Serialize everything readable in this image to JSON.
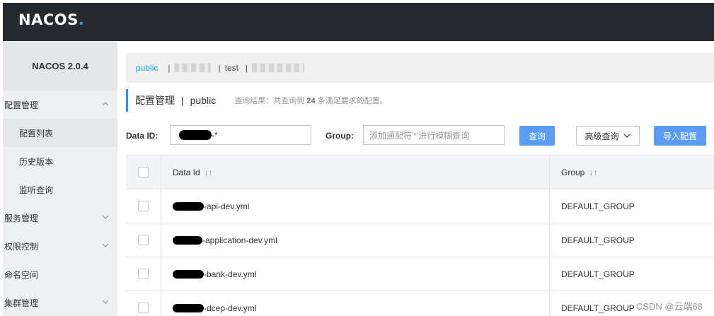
{
  "header": {
    "logo_text": "NACOS",
    "logo_dot": "."
  },
  "sidebar": {
    "version": "NACOS 2.0.4",
    "groups": [
      {
        "label": "配置管理",
        "expanded": true,
        "items": [
          {
            "label": "配置列表",
            "active": true
          },
          {
            "label": "历史版本"
          },
          {
            "label": "监听查询"
          }
        ]
      },
      {
        "label": "服务管理",
        "expanded": false
      },
      {
        "label": "权限控制",
        "expanded": false
      },
      {
        "label": "命名空间"
      },
      {
        "label": "集群管理",
        "expanded": false
      }
    ]
  },
  "namespaces": {
    "items": [
      "public",
      "test"
    ],
    "active": "public",
    "separator": "|"
  },
  "page": {
    "title": "配置管理",
    "separator": "|",
    "namespace": "public",
    "result_prefix": "查询结果：共查询到",
    "result_count": "24",
    "result_suffix": "条满足要求的配置。"
  },
  "search": {
    "data_id_label": "Data ID:",
    "data_id_value": "-*",
    "group_label": "Group:",
    "group_placeholder": "添加通配符'*'进行模糊查询",
    "query_button": "查询",
    "advanced_button": "高级查询",
    "import_button": "导入配置"
  },
  "table": {
    "columns": {
      "data_id": "Data Id",
      "group": "Group"
    },
    "rows": [
      {
        "data_id": "-api-dev.yml",
        "group": "DEFAULT_GROUP"
      },
      {
        "data_id": "-application-dev.yml",
        "group": "DEFAULT_GROUP"
      },
      {
        "data_id": "-bank-dev.yml",
        "group": "DEFAULT_GROUP"
      },
      {
        "data_id": "-dcep-dev.yml",
        "group": "DEFAULT_GROUP"
      }
    ]
  },
  "watermark": "CSDN @云端68"
}
